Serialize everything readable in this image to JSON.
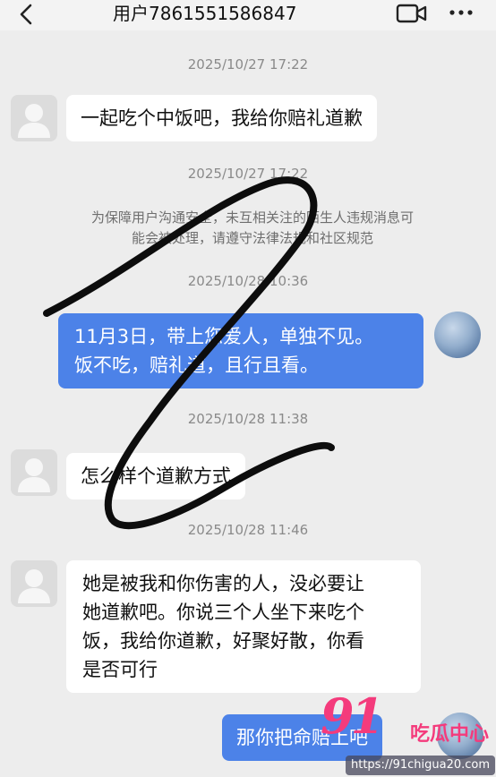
{
  "header": {
    "title": "用户7861551586847",
    "back_icon": "back-chevron-icon",
    "video_icon": "video-call-icon",
    "more_icon": "more-dots-icon"
  },
  "messages": {
    "ts1": "2025/10/27 17:22",
    "m1": "一起吃个中饭吧，我给你赔礼道歉",
    "ts2": "2025/10/27 17:22",
    "notice_line1": "为保障用户沟通安全，未互相关注的陌生人违规消息可",
    "notice_line2": "能会被处理，请遵守法律法规和社区规范",
    "ts3": "2025/10/28 10:36",
    "m2_line1": "11月3日，带上您爱人，单独不见。",
    "m2_line2": "饭不吃，赔礼道，且行且看。",
    "ts4": "2025/10/28 11:38",
    "m3": "怎么样个道歉方式",
    "ts5": "2025/10/28 11:46",
    "m4_line1": "她是被我和你伤害的人，没必要让",
    "m4_line2": "她道歉吧。你说三个人坐下来吃个",
    "m4_line3": "饭，我给你道歉，好聚好散，你看",
    "m4_line4": "是否可行",
    "m5": "那你把命赔上吧"
  },
  "watermark": {
    "logo": "91",
    "brand": "吃瓜中心",
    "url": "https://91chigua20.com"
  },
  "colors": {
    "outgoing_bubble": "#4c82e8",
    "incoming_bubble": "#ffffff",
    "background": "#ededed",
    "watermark": "#f43b7c"
  }
}
